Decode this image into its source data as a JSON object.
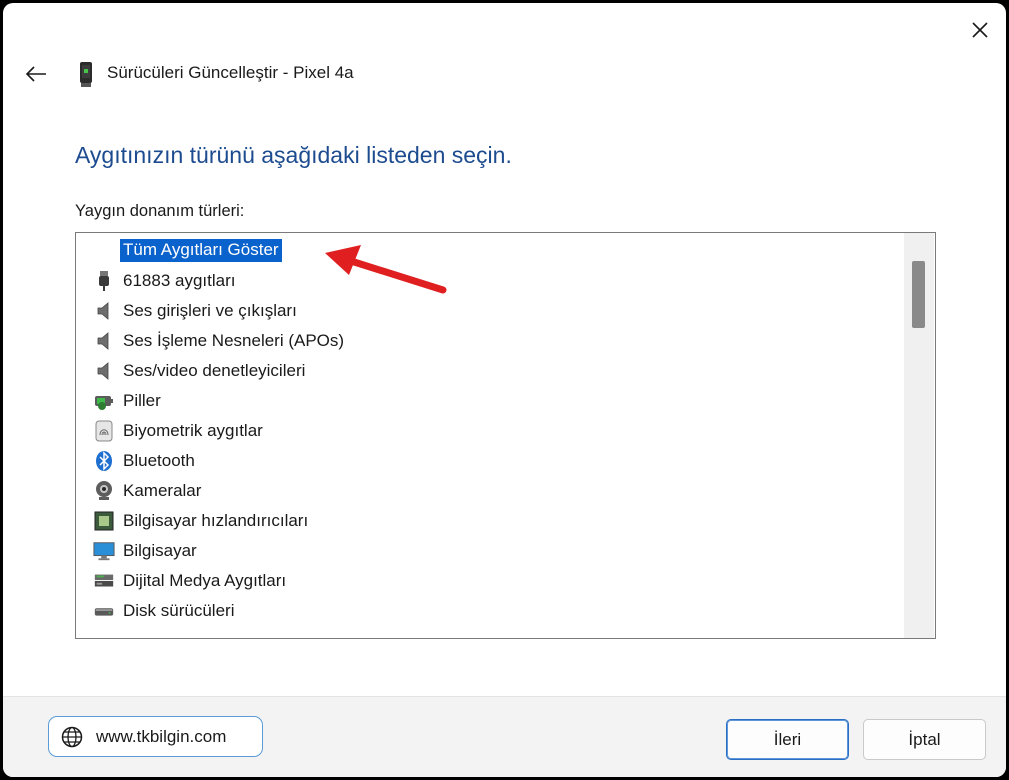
{
  "window": {
    "title": "Sürücüleri Güncelleştir - Pixel 4a"
  },
  "heading": "Aygıtınızın türünü aşağıdaki listeden seçin.",
  "list": {
    "label": "Yaygın donanım türleri:",
    "items": [
      {
        "label": "Tüm Aygıtları Göster",
        "icon": "none",
        "selected": true
      },
      {
        "label": "61883 aygıtları",
        "icon": "usb-plug-icon"
      },
      {
        "label": "Ses girişleri ve çıkışları",
        "icon": "speaker-icon"
      },
      {
        "label": "Ses İşleme Nesneleri (APOs)",
        "icon": "speaker-icon"
      },
      {
        "label": "Ses/video denetleyicileri",
        "icon": "speaker-icon"
      },
      {
        "label": "Piller",
        "icon": "battery-icon"
      },
      {
        "label": "Biyometrik aygıtlar",
        "icon": "fingerprint-icon"
      },
      {
        "label": "Bluetooth",
        "icon": "bluetooth-icon"
      },
      {
        "label": "Kameralar",
        "icon": "webcam-icon"
      },
      {
        "label": "Bilgisayar hızlandırıcıları",
        "icon": "chip-icon"
      },
      {
        "label": "Bilgisayar",
        "icon": "monitor-icon"
      },
      {
        "label": "Dijital Medya Aygıtları",
        "icon": "media-device-icon"
      },
      {
        "label": "Disk sürücüleri",
        "icon": "disk-drive-icon"
      }
    ]
  },
  "footer": {
    "website": "www.tkbilgin.com",
    "next_label": "İleri",
    "cancel_label": "İptal"
  },
  "colors": {
    "heading": "#1d4b8f",
    "selection": "#0a62cc",
    "annotation_arrow": "#e02020"
  }
}
